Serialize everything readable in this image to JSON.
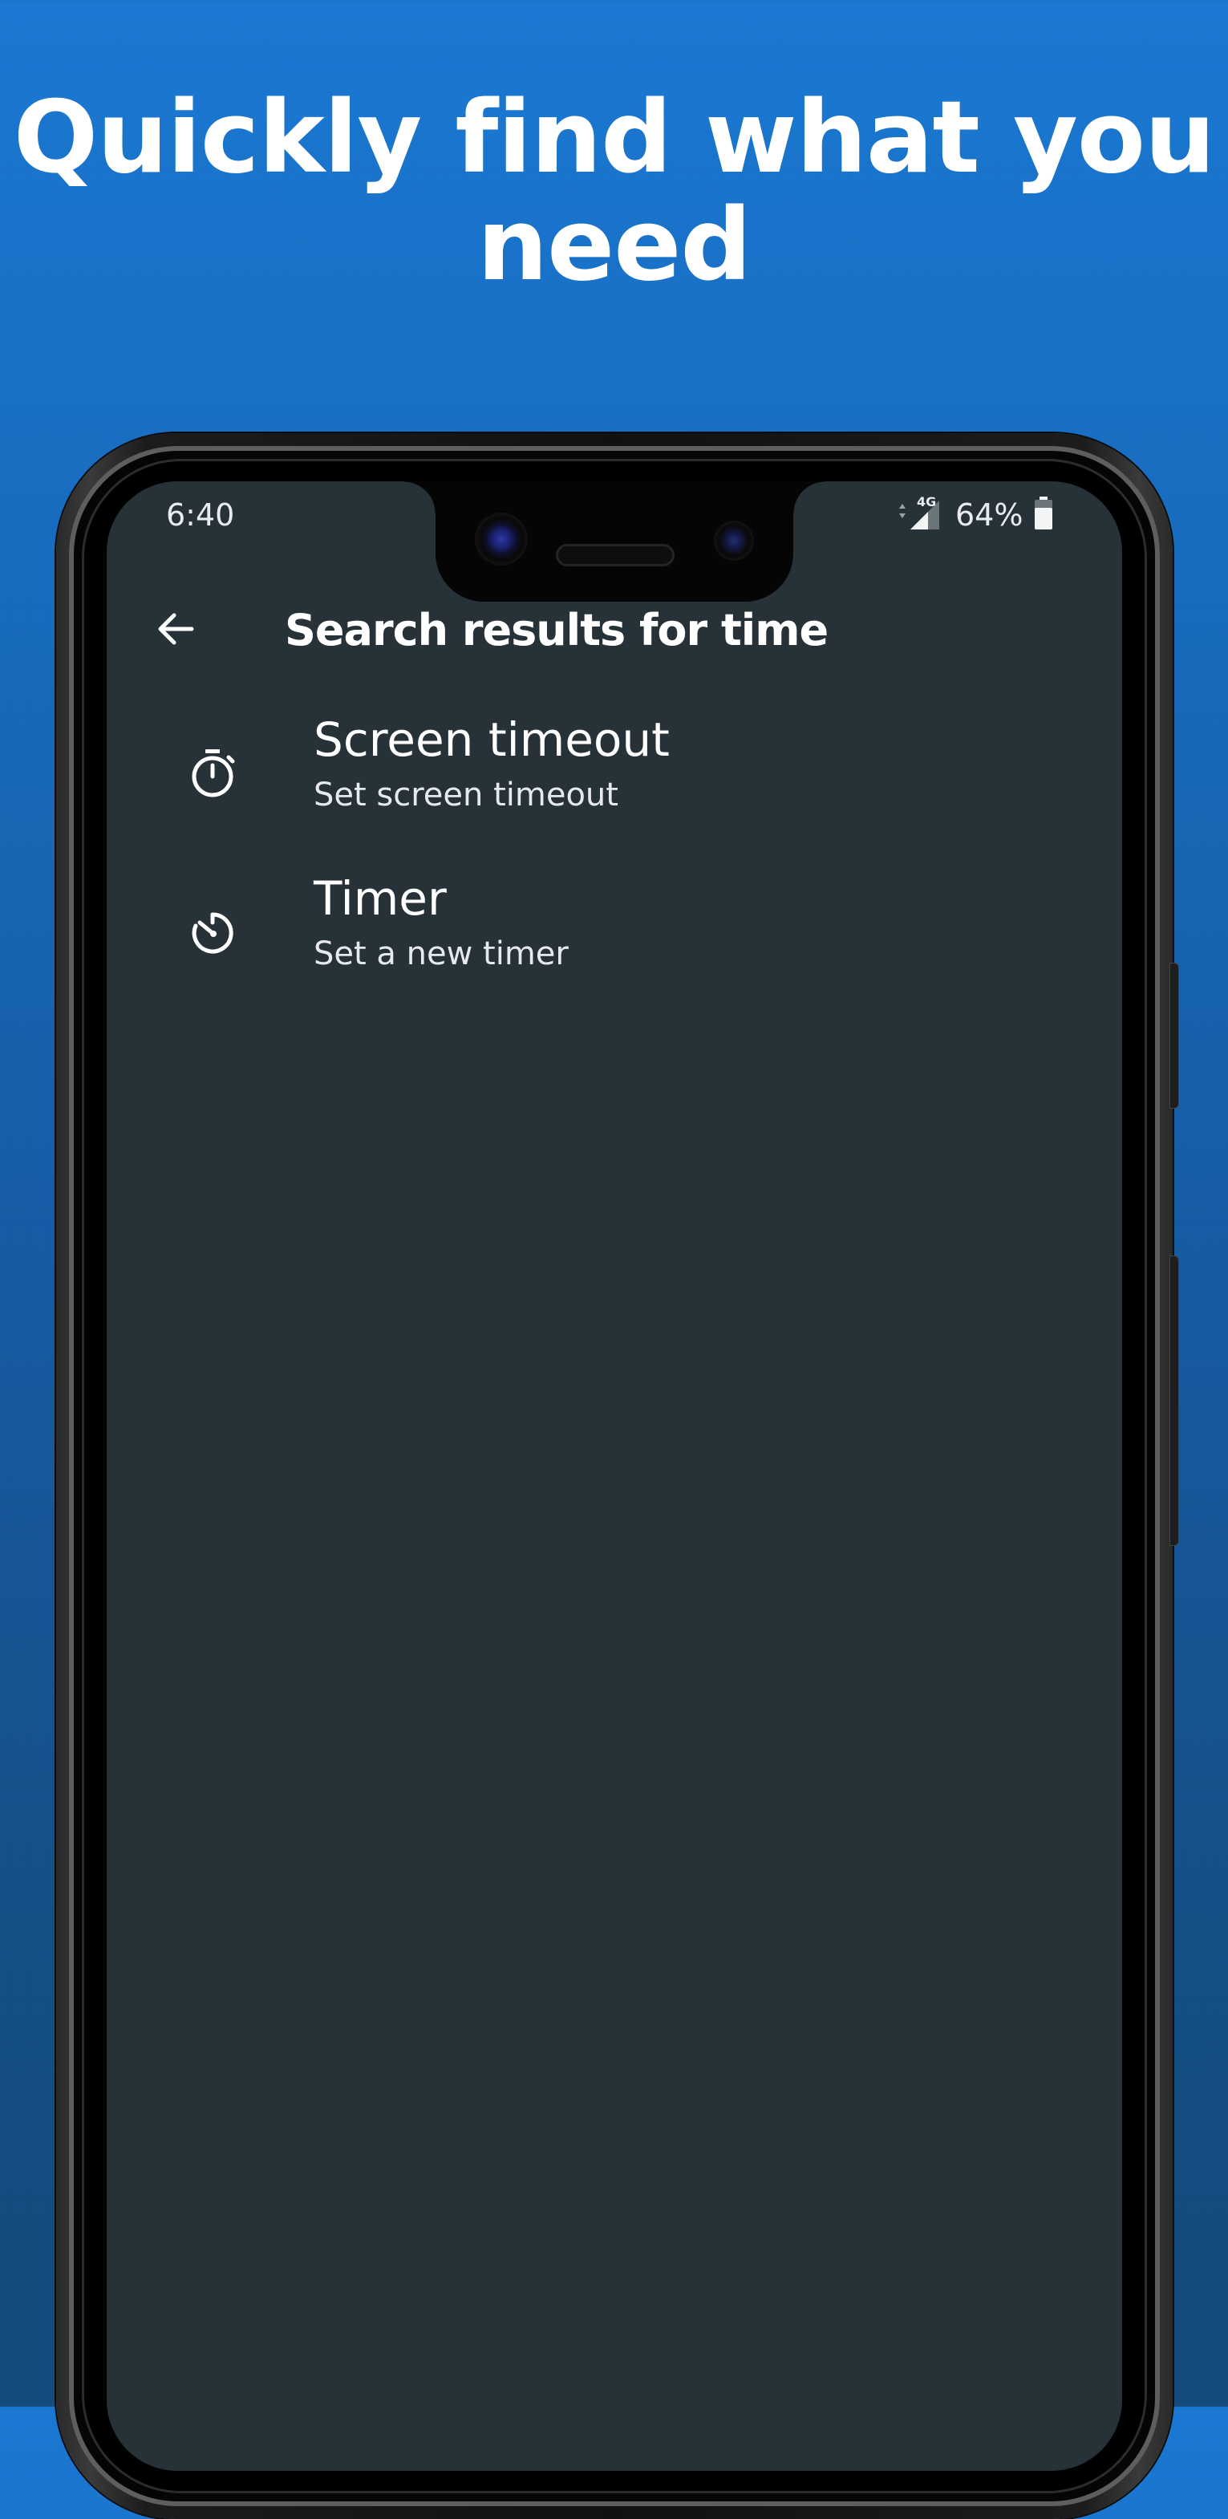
{
  "headline": {
    "line1": "Quickly find what you",
    "line2": "need"
  },
  "status_bar": {
    "time": "6:40",
    "network_type": "4G",
    "battery_percent": "64%",
    "signal_icon": "signal-icon",
    "battery_icon": "battery-icon"
  },
  "app_bar": {
    "back_icon": "arrow-back-icon",
    "title": "Search results for time"
  },
  "results": [
    {
      "icon": "stopwatch-icon",
      "title": "Screen timeout",
      "subtitle": "Set screen timeout"
    },
    {
      "icon": "timer-icon",
      "title": "Timer",
      "subtitle": "Set a new timer"
    }
  ],
  "colors": {
    "background_top": "#1a78d2",
    "background_bottom": "#154a7c",
    "screen_background": "#263238",
    "text_primary": "#ffffff"
  }
}
